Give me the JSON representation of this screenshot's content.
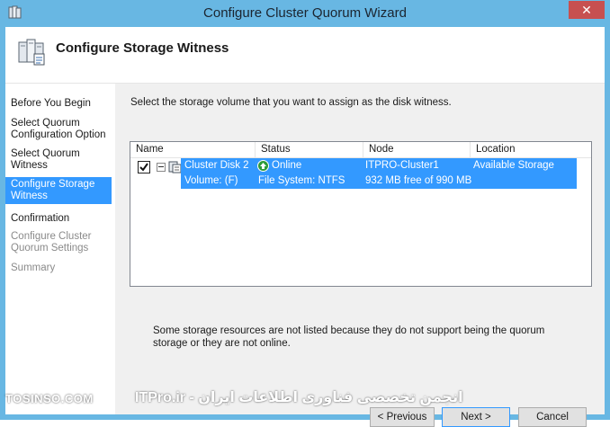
{
  "window": {
    "title": "Configure Cluster Quorum Wizard",
    "close_glyph": "✕"
  },
  "header": {
    "title": "Configure Storage Witness",
    "icon": "cluster-servers-icon"
  },
  "nav": {
    "items": [
      {
        "label": "Before You Begin",
        "state": "normal"
      },
      {
        "label": "Select Quorum Configuration Option",
        "state": "normal"
      },
      {
        "label": "Select Quorum Witness",
        "state": "normal"
      },
      {
        "label": "Configure Storage Witness",
        "state": "active"
      },
      {
        "label": "Confirmation",
        "state": "normal"
      },
      {
        "label": "Configure Cluster Quorum Settings",
        "state": "disabled"
      },
      {
        "label": "Summary",
        "state": "disabled"
      }
    ]
  },
  "main": {
    "instruction": "Select the storage volume that you want to assign as the disk witness.",
    "columns": [
      "Name",
      "Status",
      "Node",
      "Location"
    ],
    "row1": {
      "checked": true,
      "name": "Cluster Disk 2",
      "status": "Online",
      "node": "ITPRO-Cluster1",
      "location": "Available Storage"
    },
    "row2": {
      "name": "Volume: (F)",
      "status": "File System: NTFS",
      "node": "932 MB free of 990 MB"
    },
    "note": "Some storage resources are not listed because they do not support being the quorum storage or they are not online."
  },
  "buttons": {
    "previous": "< Previous",
    "next": "Next >",
    "cancel": "Cancel"
  },
  "watermark": {
    "left": "TOSINSO.COM",
    "right": "انجمن تخصصی فناوری اطلاعات ایران - ITPro.ir"
  },
  "colors": {
    "selection": "#3399ff",
    "frame": "#68b7e3",
    "close": "#c75050"
  }
}
